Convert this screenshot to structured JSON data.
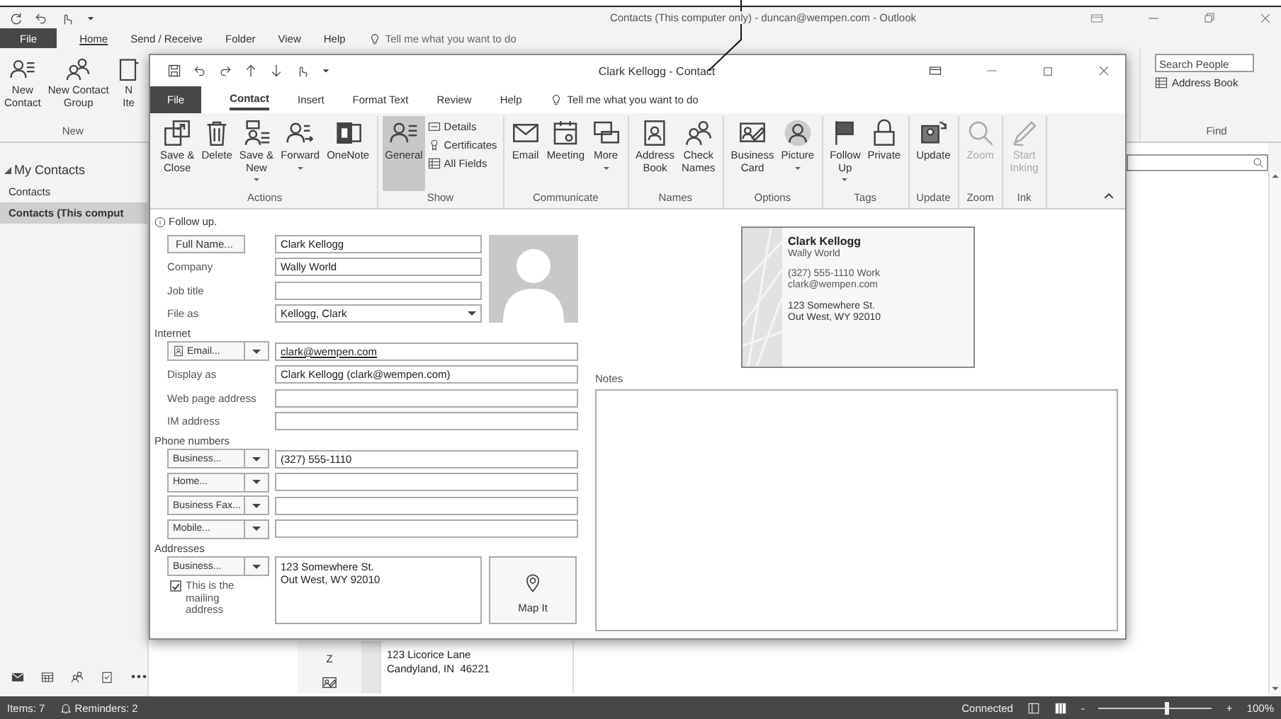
{
  "outlook": {
    "title": "Contacts (This computer only) - duncan@wempen.com - Outlook",
    "tabs": [
      {
        "label": "File",
        "kind": "file",
        "selected": false
      },
      {
        "label": "Home",
        "kind": "tab",
        "selected": true
      },
      {
        "label": "Send / Receive",
        "kind": "tab",
        "selected": false
      },
      {
        "label": "Folder",
        "kind": "tab",
        "selected": false
      },
      {
        "label": "View",
        "kind": "tab",
        "selected": false
      },
      {
        "label": "Help",
        "kind": "tab",
        "selected": false
      }
    ],
    "tell_me": "Tell me what you want to do",
    "new_group": {
      "label": "New",
      "buttons": [
        {
          "label": "New\nContact"
        },
        {
          "label": "New Contact\nGroup"
        },
        {
          "label": "N\nIte"
        }
      ]
    },
    "find_group": {
      "label": "Find",
      "search_placeholder": "Search People",
      "address_book": "Address Book"
    },
    "folders": {
      "header": "My Contacts",
      "expanded": true,
      "items": [
        {
          "label": "Contacts",
          "selected": false
        },
        {
          "label": "Contacts (This comput",
          "selected": true
        }
      ]
    },
    "list": {
      "letter": "Z",
      "card_lines": [
        "123 Licorice Lane",
        "Candyland, IN  46221"
      ]
    },
    "status_bar": {
      "items": "Items: 7",
      "reminders": "Reminders: 2",
      "connection": "Connected",
      "zoom_out": "-",
      "zoom_in": "+",
      "zoom_slider": {
        "level": 0.6
      },
      "zoom": "100%"
    }
  },
  "contact_window": {
    "title": "Clark Kellogg - Contact",
    "tabs": [
      {
        "label": "File",
        "kind": "file",
        "selected": false
      },
      {
        "label": "Contact",
        "kind": "tab",
        "selected": true
      },
      {
        "label": "Insert",
        "kind": "tab",
        "selected": false
      },
      {
        "label": "Format Text",
        "kind": "tab",
        "selected": false
      },
      {
        "label": "Review",
        "kind": "tab",
        "selected": false
      },
      {
        "label": "Help",
        "kind": "tab",
        "selected": false
      }
    ],
    "tell_me": "Tell me what you want to do",
    "ribbon_groups": [
      {
        "label": "Actions",
        "buttons": [
          {
            "label": "Save &\nClose",
            "kind": "large",
            "dropdown": false,
            "disabled": false
          },
          {
            "label": "Delete",
            "kind": "large",
            "dropdown": false,
            "disabled": false
          },
          {
            "label": "Save &\nNew",
            "kind": "large",
            "dropdown": true,
            "disabled": false
          },
          {
            "label": "Forward",
            "kind": "large",
            "dropdown": true,
            "disabled": false
          },
          {
            "label": "OneNote",
            "kind": "large",
            "dropdown": false,
            "disabled": false
          }
        ]
      },
      {
        "label": "Show",
        "buttons": [
          {
            "label": "General",
            "kind": "large",
            "dropdown": false,
            "disabled": false,
            "selected": true
          },
          {
            "label": "Details",
            "kind": "small",
            "dropdown": false,
            "disabled": false,
            "selected": false
          },
          {
            "label": "Certificates",
            "kind": "small",
            "dropdown": false,
            "disabled": false,
            "selected": false
          },
          {
            "label": "All Fields",
            "kind": "small",
            "dropdown": false,
            "disabled": false,
            "selected": false
          }
        ]
      },
      {
        "label": "Communicate",
        "buttons": [
          {
            "label": "Email",
            "kind": "large",
            "dropdown": false,
            "disabled": false
          },
          {
            "label": "Meeting",
            "kind": "large",
            "dropdown": false,
            "disabled": false
          },
          {
            "label": "More",
            "kind": "large",
            "dropdown": true,
            "disabled": false
          }
        ]
      },
      {
        "label": "Names",
        "buttons": [
          {
            "label": "Address\nBook",
            "kind": "large",
            "dropdown": false,
            "disabled": false
          },
          {
            "label": "Check\nNames",
            "kind": "large",
            "dropdown": false,
            "disabled": false
          }
        ]
      },
      {
        "label": "Options",
        "buttons": [
          {
            "label": "Business\nCard",
            "kind": "large",
            "dropdown": false,
            "disabled": false
          },
          {
            "label": "Picture",
            "kind": "large",
            "dropdown": true,
            "disabled": false
          }
        ]
      },
      {
        "label": "Tags",
        "buttons": [
          {
            "label": "Follow\nUp",
            "kind": "large",
            "dropdown": true,
            "disabled": false
          },
          {
            "label": "Private",
            "kind": "large",
            "dropdown": false,
            "disabled": false
          }
        ]
      },
      {
        "label": "Update",
        "buttons": [
          {
            "label": "Update",
            "kind": "large",
            "dropdown": false,
            "disabled": false
          }
        ]
      },
      {
        "label": "Zoom",
        "buttons": [
          {
            "label": "Zoom",
            "kind": "large",
            "dropdown": false,
            "disabled": true
          }
        ]
      },
      {
        "label": "Ink",
        "buttons": [
          {
            "label": "Start\nInking",
            "kind": "large",
            "dropdown": false,
            "disabled": true
          }
        ]
      }
    ],
    "follow_up": "Follow up.",
    "general": [
      {
        "label": "Full Name...",
        "kind": "button",
        "value": "Clark Kellogg"
      },
      {
        "label": "Company",
        "kind": "text",
        "value": "Wally World"
      },
      {
        "label": "Job title",
        "kind": "text"
      },
      {
        "label": "File as",
        "kind": "select",
        "value": "Kellogg, Clark"
      }
    ],
    "sections": [
      {
        "heading": "Internet",
        "rows": [
          {
            "label": "Email...",
            "kind": "menu-button",
            "value": "clark@wempen.com",
            "link": true
          },
          {
            "label": "Display as",
            "kind": "text",
            "value": "Clark Kellogg (clark@wempen.com)"
          },
          {
            "label": "Web page address",
            "kind": "text"
          },
          {
            "label": "IM address",
            "kind": "text"
          }
        ]
      },
      {
        "heading": "Phone numbers",
        "rows": [
          {
            "label": "Business...",
            "kind": "menu-button",
            "value": "(327) 555-1110"
          },
          {
            "label": "Home...",
            "kind": "menu-button"
          },
          {
            "label": "Business Fax...",
            "kind": "menu-button"
          },
          {
            "label": "Mobile...",
            "kind": "menu-button"
          }
        ]
      }
    ],
    "addresses": {
      "heading": "Addresses",
      "type": "Business...",
      "value": "123 Somewhere St.\nOut West, WY 92010",
      "mailing": {
        "label": "This is the mailing address",
        "checked": true
      },
      "map": "Map It"
    },
    "notes_label": "Notes",
    "business_card": {
      "name": "Clark Kellogg",
      "company": "Wally World",
      "phone": "(327) 555-1110 Work",
      "email": "clark@wempen.com",
      "address": "123 Somewhere St.\nOut West, WY 92010"
    }
  }
}
